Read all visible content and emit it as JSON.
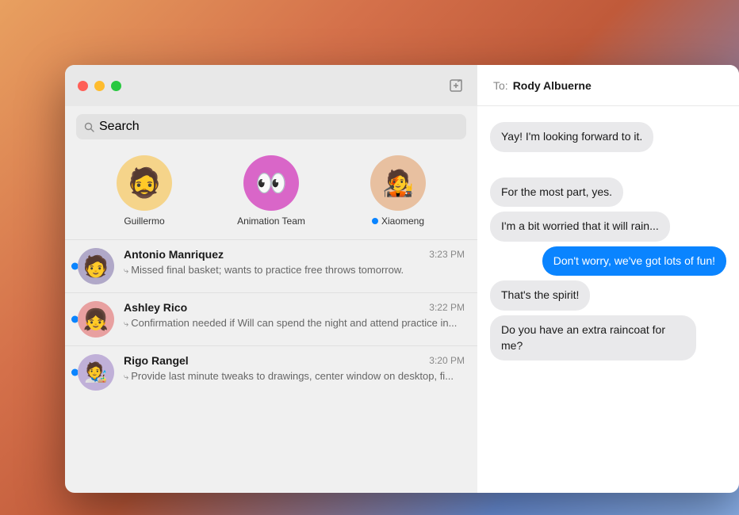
{
  "background": {
    "gradient": "orange-blue macOS desktop"
  },
  "window": {
    "titlebar": {
      "traffic_lights": [
        "red",
        "yellow",
        "green"
      ],
      "compose_button_label": "compose"
    },
    "search": {
      "placeholder": "Search"
    },
    "pinned_contacts": [
      {
        "name": "Guillermo",
        "avatar_color": "#f5d48a",
        "has_unread": false
      },
      {
        "name": "Animation Team",
        "avatar_color": "#d966c8",
        "has_unread": false
      },
      {
        "name": "Xiaomeng",
        "avatar_color": "#e8c0a0",
        "has_unread": true
      }
    ],
    "conversations": [
      {
        "name": "Antonio Manriquez",
        "time": "3:23 PM",
        "preview": "Missed final basket; wants to practice free throws tomorrow.",
        "has_unread": true,
        "avatar_bg": "#b0a8c8"
      },
      {
        "name": "Ashley Rico",
        "time": "3:22 PM",
        "preview": "Confirmation needed if Will can spend the night and attend practice in...",
        "has_unread": true,
        "avatar_bg": "#e8a0a0"
      },
      {
        "name": "Rigo Rangel",
        "time": "3:20 PM",
        "preview": "Provide last minute tweaks to drawings, center window on desktop, fi...",
        "has_unread": true,
        "avatar_bg": "#c0b0d8"
      }
    ],
    "chat": {
      "to_label": "To:",
      "to_name": "Rody Albuerne",
      "messages": [
        {
          "text": "Yay! I'm looking forward to it.",
          "type": "received"
        },
        {
          "text": "spacer",
          "type": "spacer"
        },
        {
          "text": "For the most part, yes.",
          "type": "received"
        },
        {
          "text": "I'm a bit worried that it will rain...",
          "type": "received"
        },
        {
          "text": "Don't worry, we've got lots of fun!",
          "type": "sent"
        },
        {
          "text": "That's the spirit!",
          "type": "received"
        },
        {
          "text": "Do you have an extra raincoat for me?",
          "type": "received"
        }
      ]
    }
  }
}
